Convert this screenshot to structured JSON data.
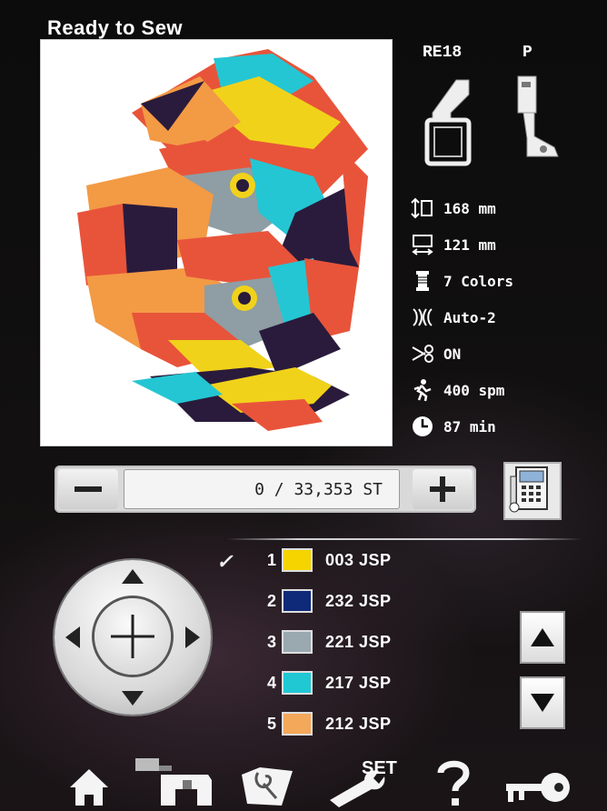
{
  "screen": {
    "title": "Ready to Sew"
  },
  "frame": {
    "label": "RE18",
    "frame_icon": "embroidery-frame-icon"
  },
  "presser_foot": {
    "label": "P",
    "foot_icon": "presser-foot-icon"
  },
  "design_info": {
    "height": "168 mm",
    "width": "121 mm",
    "colors": "7 Colors",
    "thread_cut": "Auto-2",
    "trim": "ON",
    "speed": "400 spm",
    "time": "87 min"
  },
  "stitch_counter": {
    "value": "0 / 33,353 ST",
    "minus_label": "−",
    "plus_label": "+"
  },
  "thread_colors": [
    {
      "num": "1",
      "code": "003 JSP",
      "color": "#f5d400"
    },
    {
      "num": "2",
      "code": "232 JSP",
      "color": "#0e2a78"
    },
    {
      "num": "3",
      "code": "221 JSP",
      "color": "#9aa8b0"
    },
    {
      "num": "4",
      "code": "217 JSP",
      "color": "#20c8d4"
    },
    {
      "num": "5",
      "code": "212 JSP",
      "color": "#f4a85a"
    }
  ],
  "current_color_mark": "✓",
  "toolbar": {
    "set_label": "SET",
    "icons": [
      "home-icon",
      "sewing-machine-icon",
      "open-design-icon",
      "settings-wrench-icon",
      "help-icon",
      "lock-key-icon"
    ]
  },
  "palette": {
    "accent_red": "#e8543a",
    "accent_orange": "#f39a45",
    "accent_teal": "#24c6d3",
    "accent_gray": "#8e9ea4",
    "accent_navy": "#2a1b3c",
    "accent_yellow": "#f1d21a"
  }
}
